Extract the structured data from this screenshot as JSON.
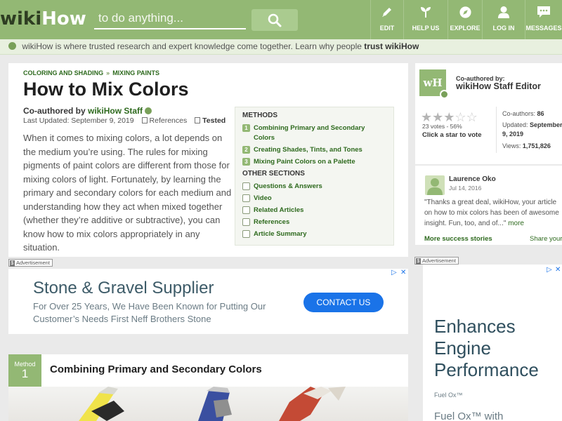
{
  "header": {
    "logo_wiki": "wiki",
    "logo_how": "How",
    "search_placeholder": "to do anything...",
    "nav": [
      {
        "label": "EDIT",
        "icon": "pencil-icon"
      },
      {
        "label": "HELP US",
        "icon": "sprout-icon"
      },
      {
        "label": "EXPLORE",
        "icon": "compass-icon"
      },
      {
        "label": "LOG IN",
        "icon": "user-icon"
      },
      {
        "label": "MESSAGES",
        "icon": "chat-icon"
      }
    ],
    "colors": {
      "bar": "#93b874",
      "accent_green": "#2e6a1e"
    }
  },
  "trustbar": {
    "text": "wikiHow is where trusted research and expert knowledge come together. Learn why people",
    "link": "trust wikiHow"
  },
  "article": {
    "breadcrumb": [
      "COLORING AND SHADING",
      "MIXING PAINTS"
    ],
    "breadcrumb_sep": "»",
    "title": "How to Mix Colors",
    "coauthored_by_label": "Co-authored by",
    "coauthor": "wikiHow Staff",
    "last_updated": "Last Updated: September 9, 2019",
    "references_label": "References",
    "tested_label": "Tested",
    "intro": "When it comes to mixing colors, a lot depends on the medium you’re using. The rules for mixing pigments of paint colors are different from those for mixing colors of light. Fortunately, by learning the primary and secondary colors for each medium and understanding how they act when mixed together (whether they’re additive or subtractive), you can know how to mix colors appropriately in any situation."
  },
  "methods_box": {
    "methods_heading": "METHODS",
    "methods": [
      {
        "num": "1",
        "label": "Combining Primary and Secondary Colors"
      },
      {
        "num": "2",
        "label": "Creating Shades, Tints, and Tones"
      },
      {
        "num": "3",
        "label": "Mixing Paint Colors on a Palette"
      }
    ],
    "other_heading": "OTHER SECTIONS",
    "other": [
      {
        "label": "Questions & Answers",
        "icon": "qa-icon"
      },
      {
        "label": "Video",
        "icon": "video-icon"
      },
      {
        "label": "Related Articles",
        "icon": "related-icon"
      },
      {
        "label": "References",
        "icon": "references-icon"
      },
      {
        "label": "Article Summary",
        "icon": "summary-icon"
      }
    ]
  },
  "ad_main": {
    "tag_label": "Advertisement",
    "tag_s": "$",
    "headline": "Stone & Gravel Supplier",
    "body": "For Over 25 Years, We Have Been Known for Putting Our Customer’s Needs First Neff Brothers Stone",
    "cta": "CONTACT US"
  },
  "method_section": {
    "badge_word": "Method",
    "badge_number": "1",
    "title": "Combining Primary and Secondary Colors"
  },
  "coauthor_card": {
    "logo_text": "wH",
    "coauthored_by": "Co-authored by:",
    "editor": "wikiHow Staff Editor",
    "rating_stars": 2.8,
    "votes": "23 votes - 56%",
    "click_prompt": "Click a star to vote",
    "stats": [
      {
        "label": "Co-authors:",
        "value": "86"
      },
      {
        "label": "Updated:",
        "value": "September 9, 2019"
      },
      {
        "label": "Views:",
        "value": "1,751,826"
      }
    ]
  },
  "testimonial": {
    "name": "Laurence Oko",
    "date": "Jul 14, 2016",
    "text": "\"Thanks a great deal, wikiHow, your article on how to mix colors has been of awesome insight. Fun, too, and of...\"",
    "more_link": "more",
    "more_stories": "More success stories",
    "share": "Share your"
  },
  "ad_side": {
    "tag_label": "Advertisement",
    "tag_s": "$",
    "headline": "Enhances Engine Performance",
    "brand": "Fuel Ox™",
    "body": "Fuel Ox™ with"
  }
}
